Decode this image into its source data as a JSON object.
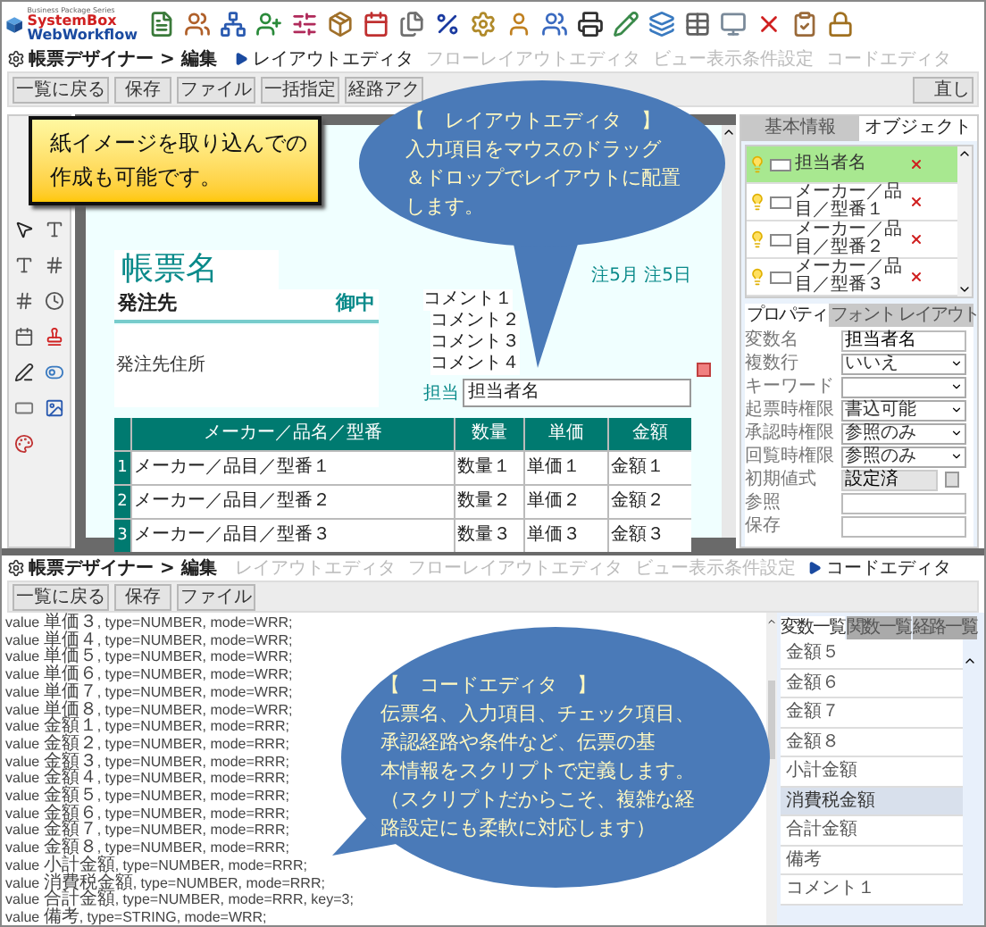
{
  "logo": {
    "tagline": "Business Package Series",
    "name_1": "SystemBox",
    "name_2": "WebWorkflow"
  },
  "layout_screen": {
    "breadcrumb": "帳票デザイナー > 編集",
    "tabs": [
      {
        "label": "レイアウトエディタ",
        "selected": true
      },
      {
        "label": "フローレイアウトエディタ",
        "selected": false
      },
      {
        "label": "ビュー表示条件設定",
        "selected": false
      },
      {
        "label": "コードエディタ",
        "selected": false
      }
    ],
    "buttons": [
      "一覧に戻る",
      "保存",
      "ファイル",
      "一括指定",
      "経路アク",
      "直し"
    ],
    "form": {
      "title": "帳票名",
      "date": "注5月 注5日",
      "recipient": "発注先",
      "honorific": "御中",
      "address": "発注先住所",
      "comments": [
        "コメント１",
        "コメント２",
        "コメント３",
        "コメント４"
      ],
      "staff_label": "担当",
      "staff_field": "担当者名",
      "table": {
        "columns": [
          "メーカー／品名／型番",
          "数量",
          "単価",
          "金額"
        ],
        "rows": [
          {
            "no": "1",
            "cells": [
              "メーカー／品目／型番１",
              "数量１",
              "単価１",
              "金額１"
            ]
          },
          {
            "no": "2",
            "cells": [
              "メーカー／品目／型番２",
              "数量２",
              "単価２",
              "金額２"
            ]
          },
          {
            "no": "3",
            "cells": [
              "メーカー／品目／型番３",
              "数量３",
              "単価３",
              "金額３"
            ]
          }
        ]
      }
    },
    "panel_tabs": [
      {
        "label": "基本情報",
        "selected": false
      },
      {
        "label": "オブジェクト",
        "selected": true
      }
    ],
    "objects": [
      {
        "name": "担当者名",
        "selected": true
      },
      {
        "name": "メーカー／品目／型番１",
        "selected": false
      },
      {
        "name": "メーカー／品目／型番２",
        "selected": false
      },
      {
        "name": "メーカー／品目／型番３",
        "selected": false
      }
    ],
    "property_tabs": [
      {
        "label": "プロパティ",
        "selected": true
      },
      {
        "label": "フォント",
        "selected": false
      },
      {
        "label": "レイアウト",
        "selected": false
      }
    ],
    "properties": [
      {
        "label": "変数名",
        "kind": "text",
        "value": "担当者名"
      },
      {
        "label": "複数行",
        "kind": "select",
        "value": "いいえ"
      },
      {
        "label": "キーワード",
        "kind": "select"
      },
      {
        "label": "起票時権限",
        "kind": "select",
        "value": "書込可能"
      },
      {
        "label": "承認時権限",
        "kind": "select",
        "value": "参照のみ"
      },
      {
        "label": "回覧時権限",
        "kind": "select",
        "value": "参照のみ"
      },
      {
        "label": "初期値式",
        "kind": "readonly",
        "value": "設定済"
      },
      {
        "label": "参照",
        "kind": "text"
      },
      {
        "label": "保存",
        "kind": "text"
      }
    ],
    "callout": {
      "title": "【　レイアウトエディタ　】",
      "lines": [
        "入力項目をマウスのドラッグ",
        "＆ドロップでレイアウトに配置",
        "します。"
      ]
    }
  },
  "note": {
    "lines": [
      "紙イメージを取り込んでの",
      "作成も可能です。"
    ]
  },
  "code_screen": {
    "breadcrumb": "帳票デザイナー > 編集",
    "tabs": [
      {
        "label": "レイアウトエディタ",
        "selected": false
      },
      {
        "label": "フローレイアウトエディタ",
        "selected": false
      },
      {
        "label": "ビュー表示条件設定",
        "selected": false
      },
      {
        "label": "コードエディタ",
        "selected": true
      }
    ],
    "buttons": [
      "一覧に戻る",
      "保存",
      "ファイル"
    ],
    "code_lines": [
      "value 単価３, type=NUMBER, mode=WRR;",
      "value 単価４, type=NUMBER, mode=WRR;",
      "value 単価５, type=NUMBER, mode=WRR;",
      "value 単価６, type=NUMBER, mode=WRR;",
      "value 単価７, type=NUMBER, mode=WRR;",
      "value 単価８, type=NUMBER, mode=WRR;",
      "value 金額１, type=NUMBER, mode=RRR;",
      "value 金額２, type=NUMBER, mode=RRR;",
      "value 金額３, type=NUMBER, mode=RRR;",
      "value 金額４, type=NUMBER, mode=RRR;",
      "value 金額５, type=NUMBER, mode=RRR;",
      "value 金額６, type=NUMBER, mode=RRR;",
      "value 金額７, type=NUMBER, mode=RRR;",
      "value 金額８, type=NUMBER, mode=RRR;",
      "value 小計金額, type=NUMBER, mode=RRR;",
      "value 消費税金額, type=NUMBER, mode=RRR;",
      "value 合計金額, type=NUMBER, mode=RRR, key=3;",
      "value 備考, type=STRING, mode=WRR;"
    ],
    "panel_tabs": [
      {
        "label": "変数一覧",
        "selected": true
      },
      {
        "label": "関数一覧",
        "selected": false
      },
      {
        "label": "経路一覧",
        "selected": false
      }
    ],
    "variables": [
      {
        "name": "金額５",
        "selected": false
      },
      {
        "name": "金額６",
        "selected": false
      },
      {
        "name": "金額７",
        "selected": false
      },
      {
        "name": "金額８",
        "selected": false
      },
      {
        "name": "小計金額",
        "selected": false
      },
      {
        "name": "消費税金額",
        "selected": true
      },
      {
        "name": "合計金額",
        "selected": false
      },
      {
        "name": "備考",
        "selected": false
      },
      {
        "name": "コメント１",
        "selected": false
      }
    ],
    "callout": {
      "title": "【　コードエディタ　】",
      "lines": [
        "伝票名、入力項目、チェック項目、",
        "承認経路や条件など、伝票の基",
        "本情報をスクリプトで定義します。",
        "（スクリプトだからこそ、複雑な経",
        "路設定にも柔軟に対応します）"
      ]
    }
  }
}
